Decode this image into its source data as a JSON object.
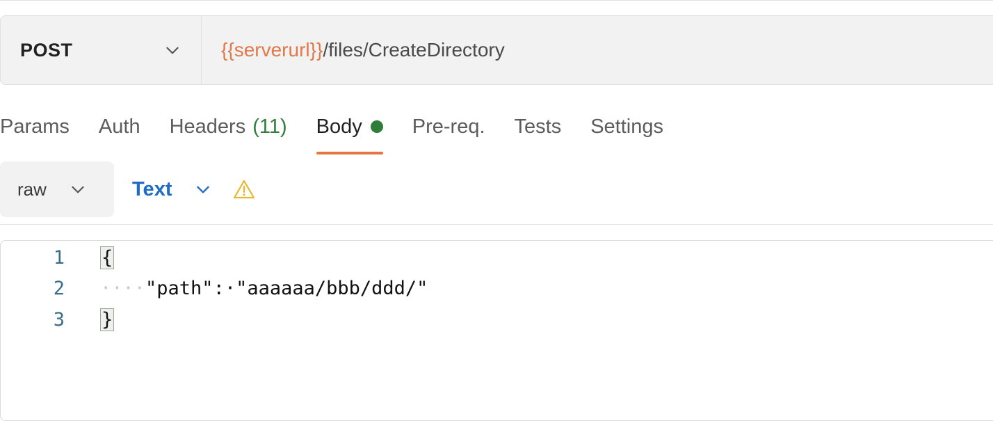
{
  "request": {
    "method": "POST",
    "url_variable": "{{serverurl}}",
    "url_path": "/files/CreateDirectory"
  },
  "tabs": [
    {
      "label": "Params"
    },
    {
      "label": "Auth"
    },
    {
      "label": "Headers",
      "count": "(11)"
    },
    {
      "label": "Body",
      "active": true
    },
    {
      "label": "Pre-req."
    },
    {
      "label": "Tests"
    },
    {
      "label": "Settings"
    }
  ],
  "body_options": {
    "mode": "raw",
    "language": "Text"
  },
  "editor": {
    "lines": [
      {
        "number": "1",
        "text": "{"
      },
      {
        "number": "2",
        "indent": "····",
        "text": "\"path\":·\"aaaaaa/bbb/ddd/\""
      },
      {
        "number": "3",
        "text": "}"
      }
    ]
  },
  "colors": {
    "accent_tab": "#e8743f",
    "url_variable": "#e0794a",
    "body_dot": "#2f7d3a",
    "language_link": "#1f6bc7",
    "warning": "#e8b730"
  },
  "icons": {
    "method_dropdown": "chevron-down-icon",
    "mode_dropdown": "chevron-down-icon",
    "language_dropdown": "chevron-down-icon",
    "warning": "warning-icon"
  }
}
